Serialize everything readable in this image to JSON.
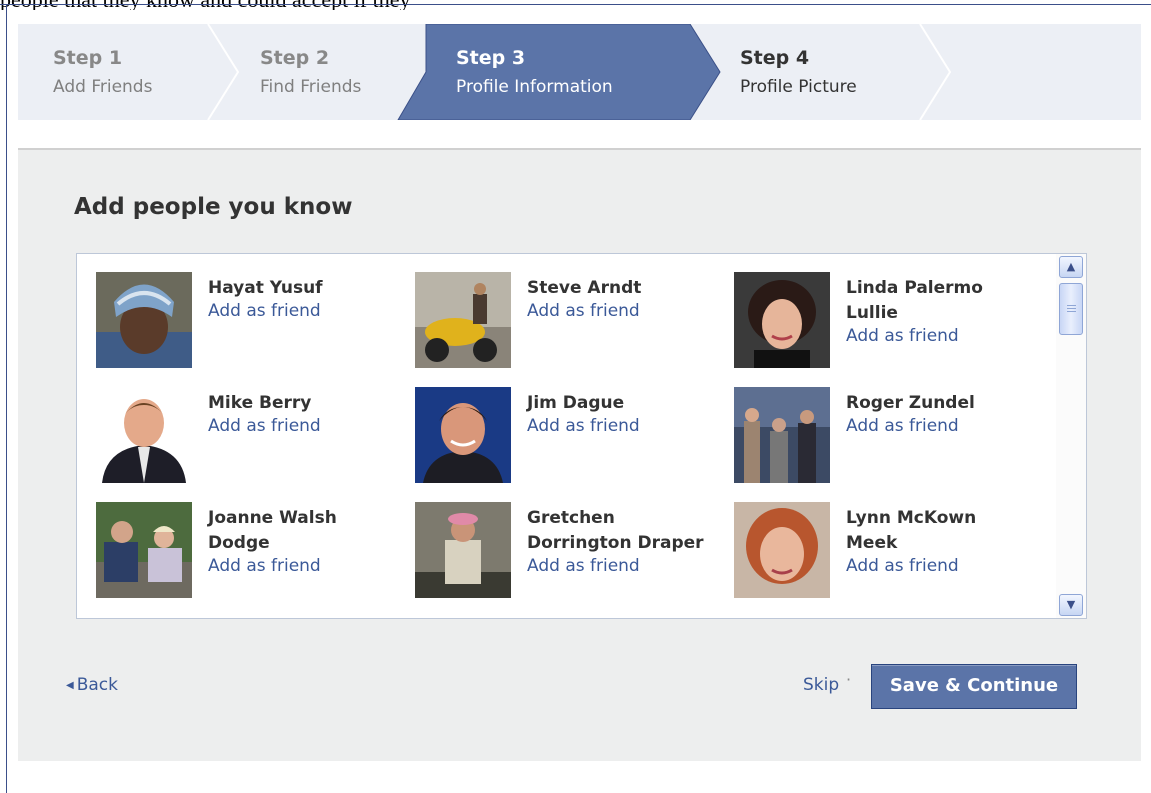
{
  "top_text": "people that they know and could accept if they",
  "steps": [
    {
      "num": "Step 1",
      "label": "Add Friends"
    },
    {
      "num": "Step 2",
      "label": "Find Friends"
    },
    {
      "num": "Step 3",
      "label": "Profile Information"
    },
    {
      "num": "Step 4",
      "label": "Profile Picture"
    }
  ],
  "active_step": 3,
  "colors": {
    "accent": "#5b74a8",
    "link": "#3b5998",
    "steps_bg": "#eceff5",
    "panel_bg": "#edeeee"
  },
  "panel": {
    "title": "Add people you know"
  },
  "people": [
    {
      "name": "Hayat Yusuf",
      "action": "Add as friend"
    },
    {
      "name": "Steve Arndt",
      "action": "Add as friend"
    },
    {
      "name": "Linda Palermo Lullie",
      "action": "Add as friend"
    },
    {
      "name": "Mike Berry",
      "action": "Add as friend"
    },
    {
      "name": "Jim Dague",
      "action": "Add as friend"
    },
    {
      "name": "Roger Zundel",
      "action": "Add as friend"
    },
    {
      "name": "Joanne Walsh Dodge",
      "action": "Add as friend"
    },
    {
      "name": "Gretchen Dorrington Draper",
      "action": "Add as friend"
    },
    {
      "name": "Lynn McKown Meek",
      "action": "Add as friend"
    }
  ],
  "footer": {
    "back_label": "Back",
    "skip_label": "Skip",
    "separator": "·",
    "save_label": "Save & Continue"
  },
  "icons": {
    "back": "triangle-left-icon",
    "scroll_up": "chevron-up-icon",
    "scroll_down": "chevron-down-icon"
  }
}
